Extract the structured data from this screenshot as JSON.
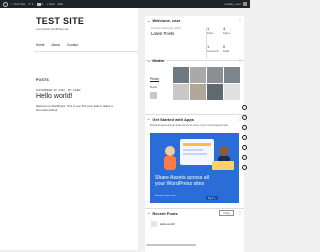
{
  "adminbar": {
    "items": [
      "Test Site",
      "1",
      "0",
      "+ New",
      "Edit"
    ],
    "greeting": "Howdy, user"
  },
  "site": {
    "title": "TEST SITE",
    "tagline": "Just another WordPress site",
    "nav": [
      "Home",
      "About",
      "Contact"
    ],
    "posts_label": "POSTS",
    "post": {
      "meta": "NOVEMBER 30, 2022 · BY USER",
      "title": "Hello world!",
      "excerpt": "Welcome to WordPress. This is your first post. Edit or delete it, then start writing!"
    }
  },
  "panel": {
    "welcome": {
      "title": "Welcome, user",
      "line": "Currently reading this article",
      "latest_label": "Latest Posts",
      "stats": [
        {
          "value": "1",
          "label": "Posts"
        },
        {
          "value": "4",
          "label": "Pages"
        },
        {
          "value": "1",
          "label": "Comments"
        },
        {
          "value": "0",
          "label": "Drafts"
        }
      ]
    },
    "media": {
      "title": "Media",
      "tab": "Photo",
      "sub": "Media",
      "images": 8
    },
    "apps": {
      "title": "Get Started with Apps",
      "desc": "Download apps and get quick access to some of your most frequent tools.",
      "promo_text": "Share Assets across all your WordPress sites",
      "promo_sub": "Manage all your sites",
      "promo_btn": "Try it →"
    },
    "recent": {
      "title": "Recent Posts",
      "filter": "Today",
      "post_title": "Hello world!"
    }
  },
  "colors": {
    "adminbar": "#1d2327",
    "promo": "#2a6dd9"
  }
}
